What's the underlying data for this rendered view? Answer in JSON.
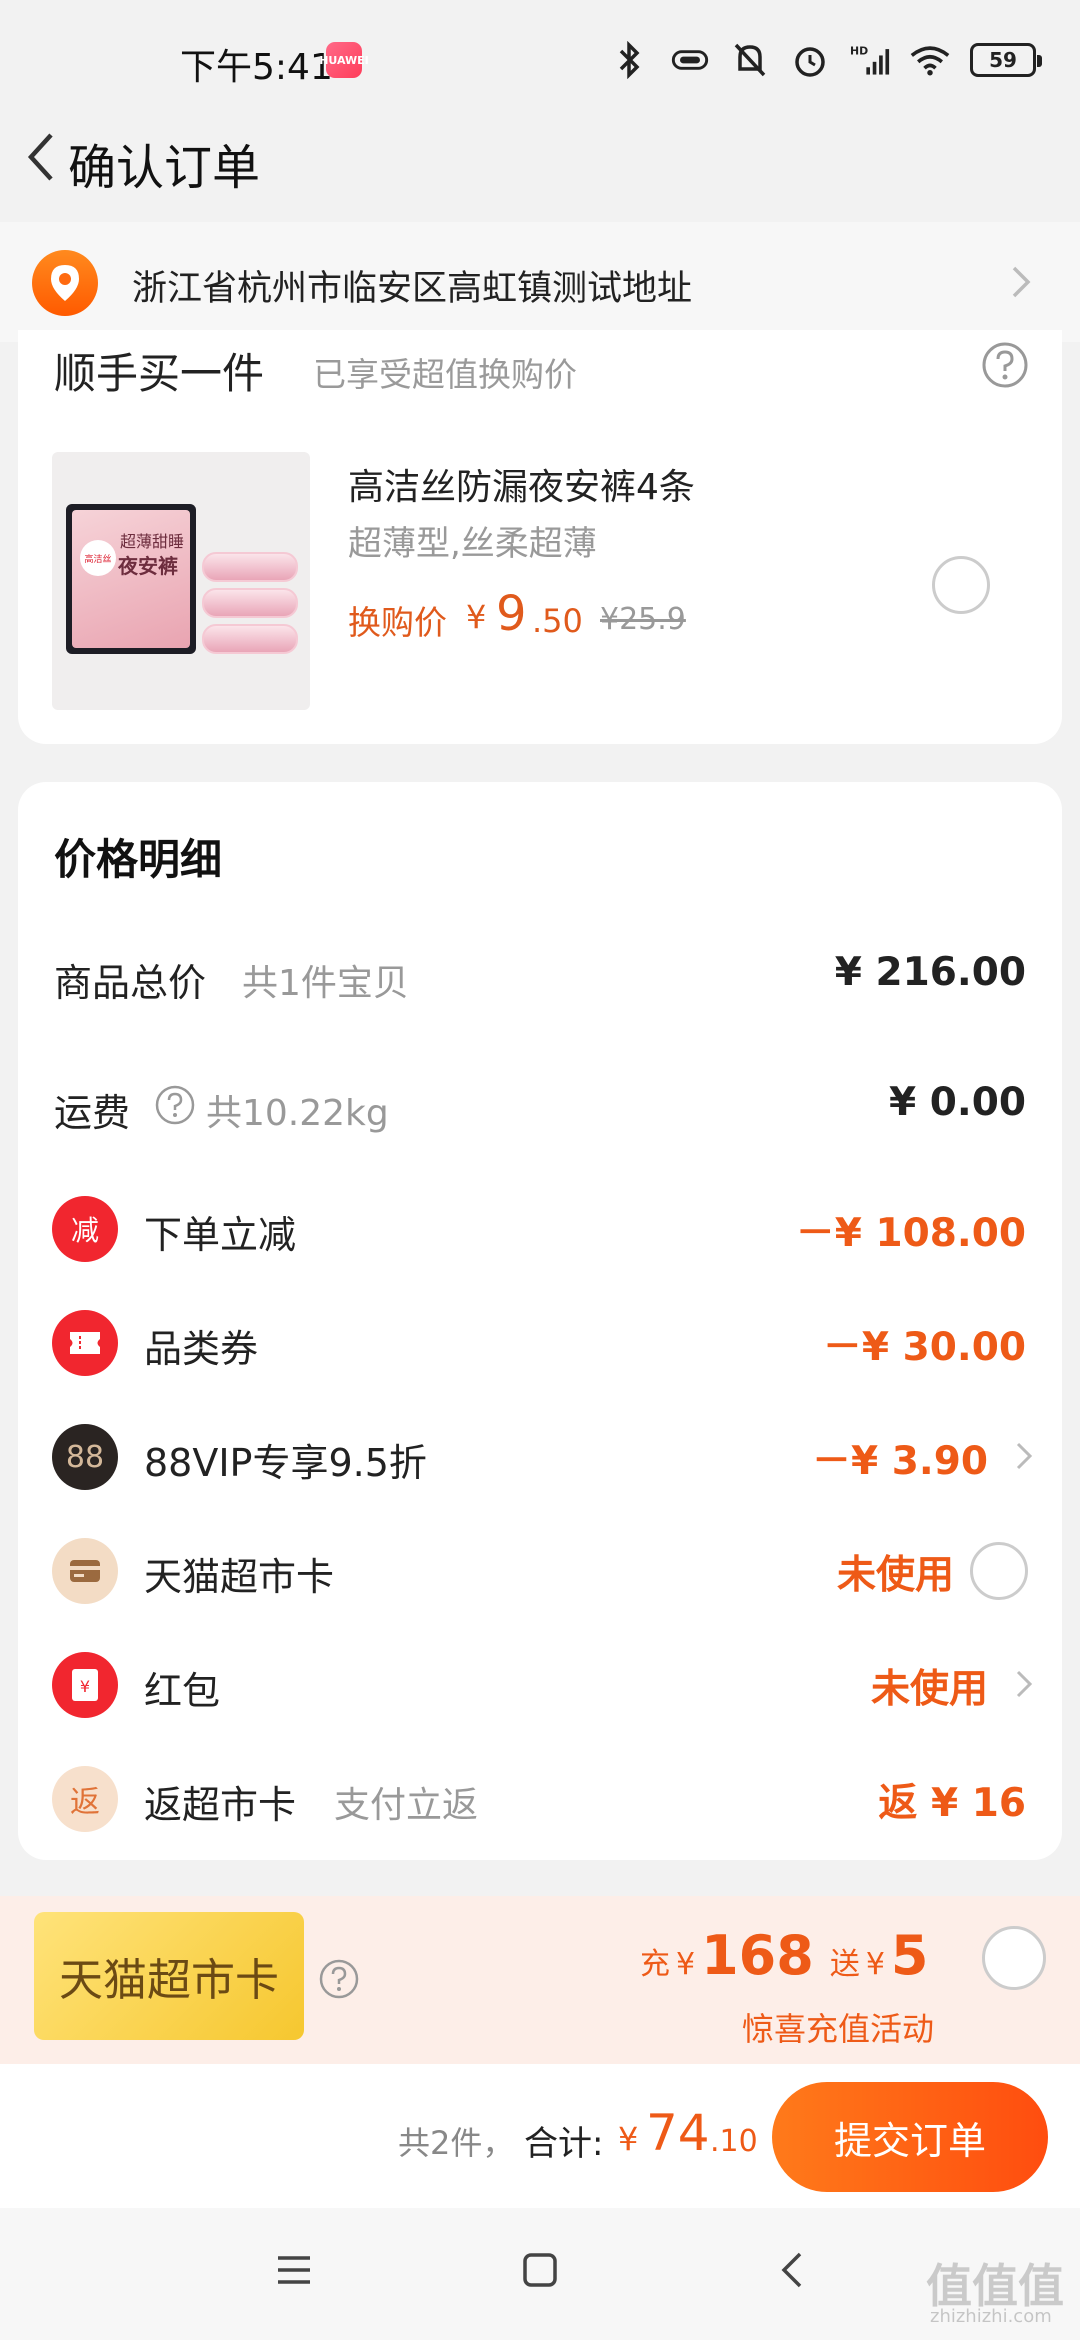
{
  "status": {
    "time": "下午5:41",
    "app_badge": "HUAWEI",
    "battery": "59"
  },
  "header": {
    "title": "确认订单"
  },
  "address": {
    "text": "浙江省杭州市临安区高虹镇测试地址"
  },
  "extra_purchase": {
    "title": "顺手买一件",
    "subtitle": "已享受超值换购价",
    "product": {
      "name": "高洁丝防漏夜安裤4条",
      "spec": "超薄型,丝柔超薄",
      "price_label": "换购价",
      "price_yen": "¥",
      "price_int": "9",
      "price_dec": ".50",
      "original_price": "¥25.9",
      "pkg_text1": "超薄甜睡",
      "pkg_text2": "夜安裤",
      "pkg_brand": "高洁丝"
    }
  },
  "price_detail": {
    "title": "价格明细",
    "rows": [
      {
        "label": "商品总价",
        "note": "共1件宝贝",
        "amount": "¥ 216.00"
      },
      {
        "label": "运费",
        "note": "共10.22kg",
        "amount": "¥ 0.00"
      },
      {
        "label": "下单立减",
        "icon": "减",
        "amount": "－¥ 108.00"
      },
      {
        "label": "品类券",
        "amount": "－¥ 30.00"
      },
      {
        "label": "88VIP专享9.5折",
        "icon": "88",
        "amount": "－¥ 3.90"
      },
      {
        "label": "天猫超市卡",
        "amount": "未使用"
      },
      {
        "label": "红包",
        "icon": "¥",
        "amount": "未使用"
      },
      {
        "label": "返超市卡",
        "note": "支付立返",
        "icon": "返",
        "amount": "返 ¥ 16"
      }
    ]
  },
  "promo": {
    "card_label": "天猫超市卡",
    "charge_prefix": "充",
    "yen1": "¥",
    "charge_amount": "168",
    "gift_prefix": "送",
    "yen2": "¥",
    "gift_amount": "5",
    "subtitle": "惊喜充值活动"
  },
  "footer": {
    "count": "共2件，",
    "total_label": "合计:",
    "total_yen": "¥",
    "total_int": "74",
    "total_dec": ".10",
    "submit_label": "提交订单"
  },
  "watermark": {
    "text": "值值值",
    "sub": "zhizhizhi.com"
  },
  "colors": {
    "accent": "#ee5a17",
    "red": "#f1262f",
    "submit_start": "#ff7a1a",
    "submit_end": "#ff4d0f"
  }
}
